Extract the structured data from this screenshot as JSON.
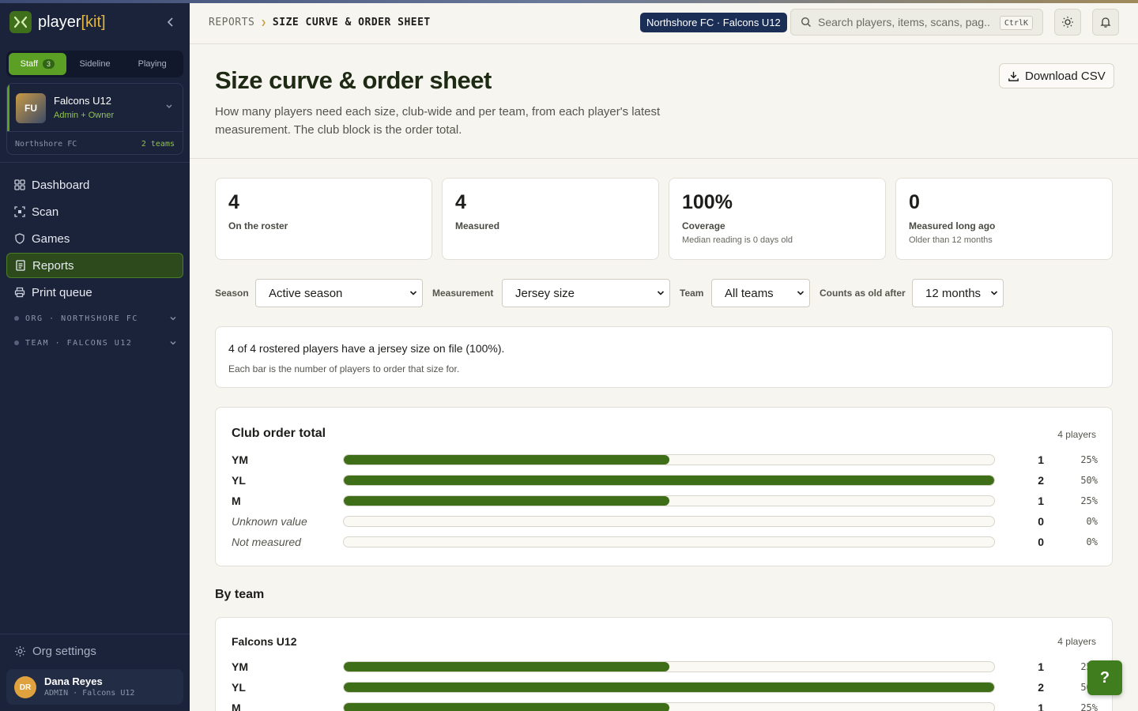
{
  "brand": {
    "name_prefix": "player",
    "name_kit": "[kit]"
  },
  "sidebar": {
    "modes": [
      {
        "label": "Staff",
        "badge": "3",
        "active": true
      },
      {
        "label": "Sideline",
        "active": false
      },
      {
        "label": "Playing",
        "active": false
      }
    ],
    "team_card": {
      "initials": "FU",
      "name": "Falcons U12",
      "role": "Admin + Owner",
      "org": "Northshore FC",
      "team_count": "2 teams"
    },
    "nav": [
      {
        "label": "Dashboard",
        "icon": "grid-icon",
        "active": false
      },
      {
        "label": "Scan",
        "icon": "qr-scan-icon",
        "active": false
      },
      {
        "label": "Games",
        "icon": "shield-icon",
        "active": false
      },
      {
        "label": "Reports",
        "icon": "document-icon",
        "active": true
      },
      {
        "label": "Print queue",
        "icon": "printer-icon",
        "active": false
      }
    ],
    "groups": [
      {
        "label": "ORG · NORTHSHORE FC"
      },
      {
        "label": "TEAM · FALCONS U12"
      }
    ],
    "org_settings": "Org settings",
    "user": {
      "initials": "DR",
      "name": "Dana Reyes",
      "subtitle": "ADMIN · Falcons U12"
    }
  },
  "topbar": {
    "breadcrumb_parent": "REPORTS",
    "breadcrumb_current": "SIZE CURVE & ORDER SHEET",
    "context": "Northshore FC · Falcons U12",
    "search_placeholder": "Search players, items, scans, pag...",
    "search_shortcut": "CtrlK"
  },
  "header": {
    "title": "Size curve & order sheet",
    "description": "How many players need each size, club-wide and per team, from each player's latest measurement. The club block is the order total.",
    "download_label": "Download CSV"
  },
  "stats": [
    {
      "value": "4",
      "label": "On the roster",
      "sub": ""
    },
    {
      "value": "4",
      "label": "Measured",
      "sub": ""
    },
    {
      "value": "100%",
      "label": "Coverage",
      "sub": "Median reading is 0 days old"
    },
    {
      "value": "0",
      "label": "Measured long ago",
      "sub": "Older than 12 months"
    }
  ],
  "filters": {
    "season": {
      "label": "Season",
      "value": "Active season"
    },
    "measurement": {
      "label": "Measurement",
      "value": "Jersey size"
    },
    "team": {
      "label": "Team",
      "value": "All teams"
    },
    "old_after": {
      "label": "Counts as old after",
      "value": "12 months"
    }
  },
  "summary": {
    "main": "4 of 4 rostered players have a jersey size on file (100%).",
    "note": "Each bar is the number of players to order that size for."
  },
  "club_total": {
    "title": "Club order total",
    "count_label": "4 players",
    "rows": [
      {
        "label": "YM",
        "count": "1",
        "pct": "25%",
        "share": 0.5,
        "unknown": false
      },
      {
        "label": "YL",
        "count": "2",
        "pct": "50%",
        "share": 1.0,
        "unknown": false
      },
      {
        "label": "M",
        "count": "1",
        "pct": "25%",
        "share": 0.5,
        "unknown": false
      },
      {
        "label": "Unknown value",
        "count": "0",
        "pct": "0%",
        "share": 0,
        "unknown": true
      },
      {
        "label": "Not measured",
        "count": "0",
        "pct": "0%",
        "share": 0,
        "unknown": true
      }
    ]
  },
  "by_team_heading": "By team",
  "team_block": {
    "title": "Falcons U12",
    "count_label": "4 players",
    "rows": [
      {
        "label": "YM",
        "count": "1",
        "pct": "25%",
        "share": 0.5,
        "unknown": false
      },
      {
        "label": "YL",
        "count": "2",
        "pct": "50%",
        "share": 1.0,
        "unknown": false
      },
      {
        "label": "M",
        "count": "1",
        "pct": "25%",
        "share": 0.5,
        "unknown": false
      }
    ]
  },
  "help_label": "?",
  "colors": {
    "accent_green": "#3f6e18",
    "sidebar_bg": "#1b233a",
    "context_badge": "#1b2e55"
  }
}
